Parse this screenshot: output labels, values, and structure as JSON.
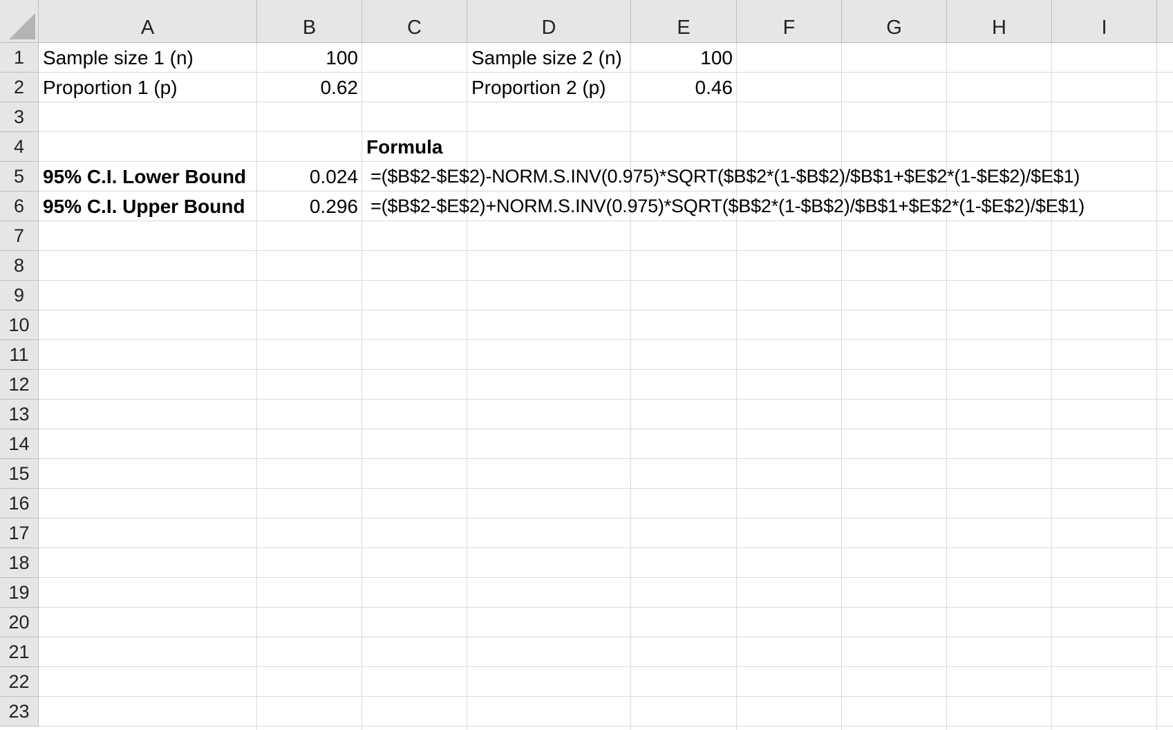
{
  "columns": [
    "A",
    "B",
    "C",
    "D",
    "E",
    "F",
    "G",
    "H",
    "I"
  ],
  "rows": [
    "1",
    "2",
    "3",
    "4",
    "5",
    "6",
    "7",
    "8",
    "9",
    "10",
    "11",
    "12",
    "13",
    "14",
    "15",
    "16",
    "17",
    "18",
    "19",
    "20",
    "21",
    "22",
    "23"
  ],
  "cells": {
    "A1": "Sample size 1 (n)",
    "B1": "100",
    "D1": "Sample size 2 (n)",
    "E1": "100",
    "A2": "Proportion 1 (p)",
    "B2": "0.62",
    "D2": "Proportion 2 (p)",
    "E2": "0.46",
    "C4": "Formula",
    "A5": "95% C.I. Lower Bound",
    "B5": "0.024",
    "C5": "=($B$2-$E$2)-NORM.S.INV(0.975)*SQRT($B$2*(1-$B$2)/$B$1+$E$2*(1-$E$2)/$E$1)",
    "A6": "95% C.I. Upper Bound",
    "B6": "0.296",
    "C6": "=($B$2-$E$2)+NORM.S.INV(0.975)*SQRT($B$2*(1-$B$2)/$B$1+$E$2*(1-$E$2)/$E$1)"
  },
  "colors": {
    "header_bg": "#e6e6e6",
    "gridline": "#d9d9d9"
  }
}
